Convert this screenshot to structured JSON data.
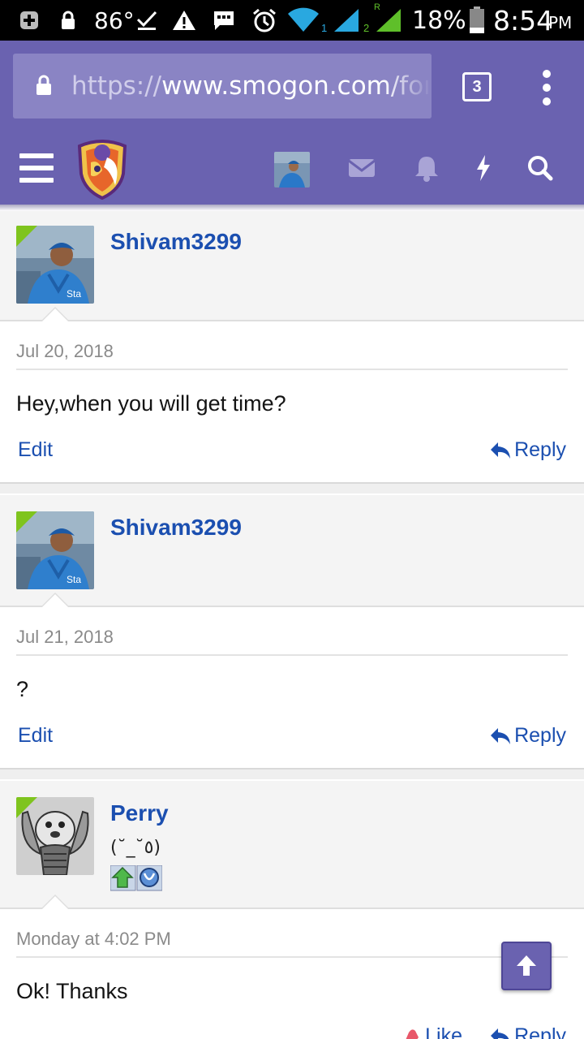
{
  "status_bar": {
    "temperature": "86°",
    "sim1": "1",
    "sim2": "2",
    "roaming": "R",
    "battery": "18%",
    "time": "8:54",
    "ampm": "PM",
    "icons": [
      "plus-icon",
      "lock-icon",
      "check-icon",
      "warning-icon",
      "message-icon",
      "alarm-icon",
      "wifi-icon",
      "signal-icon",
      "battery-icon"
    ]
  },
  "browser": {
    "url_scheme": "https://",
    "url_host": "www.smogon.com/for",
    "tab_count": "3"
  },
  "nav": {
    "icons": [
      "menu-icon",
      "smogon-logo",
      "user-avatar",
      "envelope-icon",
      "bell-icon",
      "lightning-icon",
      "search-icon"
    ],
    "accent": "#6a62b0"
  },
  "posts": [
    {
      "username": "Shivam3299",
      "date": "Jul 20, 2018",
      "text": "Hey,when you will get time?",
      "edit": "Edit",
      "reply": "Reply"
    },
    {
      "username": "Shivam3299",
      "date": "Jul 21, 2018",
      "text": "?",
      "edit": "Edit",
      "reply": "Reply"
    },
    {
      "username": "Perry",
      "user_title": "(˘_˘٥)",
      "date": "Monday at 4:02 PM",
      "text": "Ok! Thanks",
      "like": "Like",
      "reply": "Reply"
    }
  ],
  "colors": {
    "link": "#1b4fb0",
    "online": "#7fc41e",
    "header_bg": "#f4f4f4"
  }
}
